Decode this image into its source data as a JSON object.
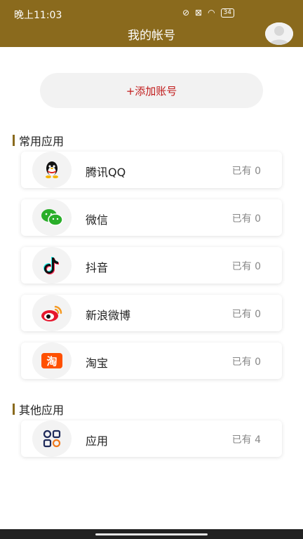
{
  "status": {
    "time": "晚上11:03",
    "battery": "34"
  },
  "header": {
    "title": "我的帐号"
  },
  "add_button": {
    "label": "+添加账号"
  },
  "sections": [
    {
      "title": "常用应用",
      "items": [
        {
          "name": "腾讯QQ",
          "count": "已有 0",
          "icon": "qq-icon"
        },
        {
          "name": "微信",
          "count": "已有 0",
          "icon": "wechat-icon"
        },
        {
          "name": "抖音",
          "count": "已有 0",
          "icon": "douyin-icon"
        },
        {
          "name": "新浪微博",
          "count": "已有 0",
          "icon": "weibo-icon"
        },
        {
          "name": "淘宝",
          "count": "已有 0",
          "icon": "taobao-icon"
        }
      ]
    },
    {
      "title": "其他应用",
      "items": [
        {
          "name": "应用",
          "count": "已有 4",
          "icon": "apps-icon"
        }
      ]
    }
  ],
  "colors": {
    "header": "#8a6a1d",
    "accent_red": "#c11b1b"
  }
}
